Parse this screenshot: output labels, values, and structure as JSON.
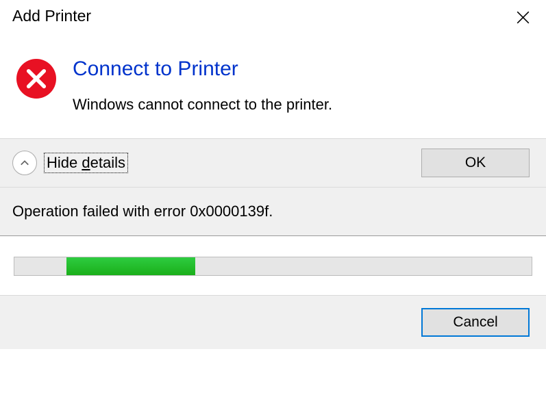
{
  "titlebar": {
    "title": "Add Printer"
  },
  "dialog": {
    "headline": "Connect to Printer",
    "message": "Windows cannot connect to the printer."
  },
  "actions": {
    "details_toggle_label_prefix": "Hide ",
    "details_toggle_label_underline": "d",
    "details_toggle_label_suffix": "etails",
    "ok_label": "OK"
  },
  "details": {
    "error_text": "Operation failed with error 0x0000139f."
  },
  "progress": {
    "start_percent": 10,
    "end_percent": 35
  },
  "footer": {
    "cancel_label": "Cancel"
  }
}
